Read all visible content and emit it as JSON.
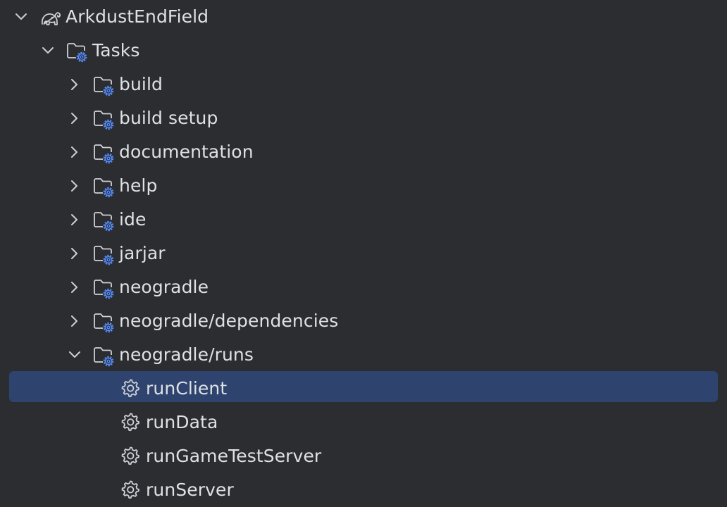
{
  "colors": {
    "background": "#2b2d30",
    "text": "#dfe1e5",
    "selection": "#2e436e",
    "icon_stroke": "#ced0d6",
    "gear_accent": "#548af7"
  },
  "tree": {
    "root": {
      "label": "ArkdustEndField",
      "expanded": true,
      "icon": "gradle-elephant-icon"
    },
    "tasks": {
      "label": "Tasks",
      "expanded": true,
      "icon": "task-folder-icon"
    },
    "groups": [
      {
        "label": "build",
        "expanded": false
      },
      {
        "label": "build setup",
        "expanded": false
      },
      {
        "label": "documentation",
        "expanded": false
      },
      {
        "label": "help",
        "expanded": false
      },
      {
        "label": "ide",
        "expanded": false
      },
      {
        "label": "jarjar",
        "expanded": false
      },
      {
        "label": "neogradle",
        "expanded": false
      },
      {
        "label": "neogradle/dependencies",
        "expanded": false
      },
      {
        "label": "neogradle/runs",
        "expanded": true
      }
    ],
    "tasks_list": [
      {
        "label": "runClient",
        "selected": true
      },
      {
        "label": "runData",
        "selected": false
      },
      {
        "label": "runGameTestServer",
        "selected": false
      },
      {
        "label": "runServer",
        "selected": false
      }
    ]
  }
}
